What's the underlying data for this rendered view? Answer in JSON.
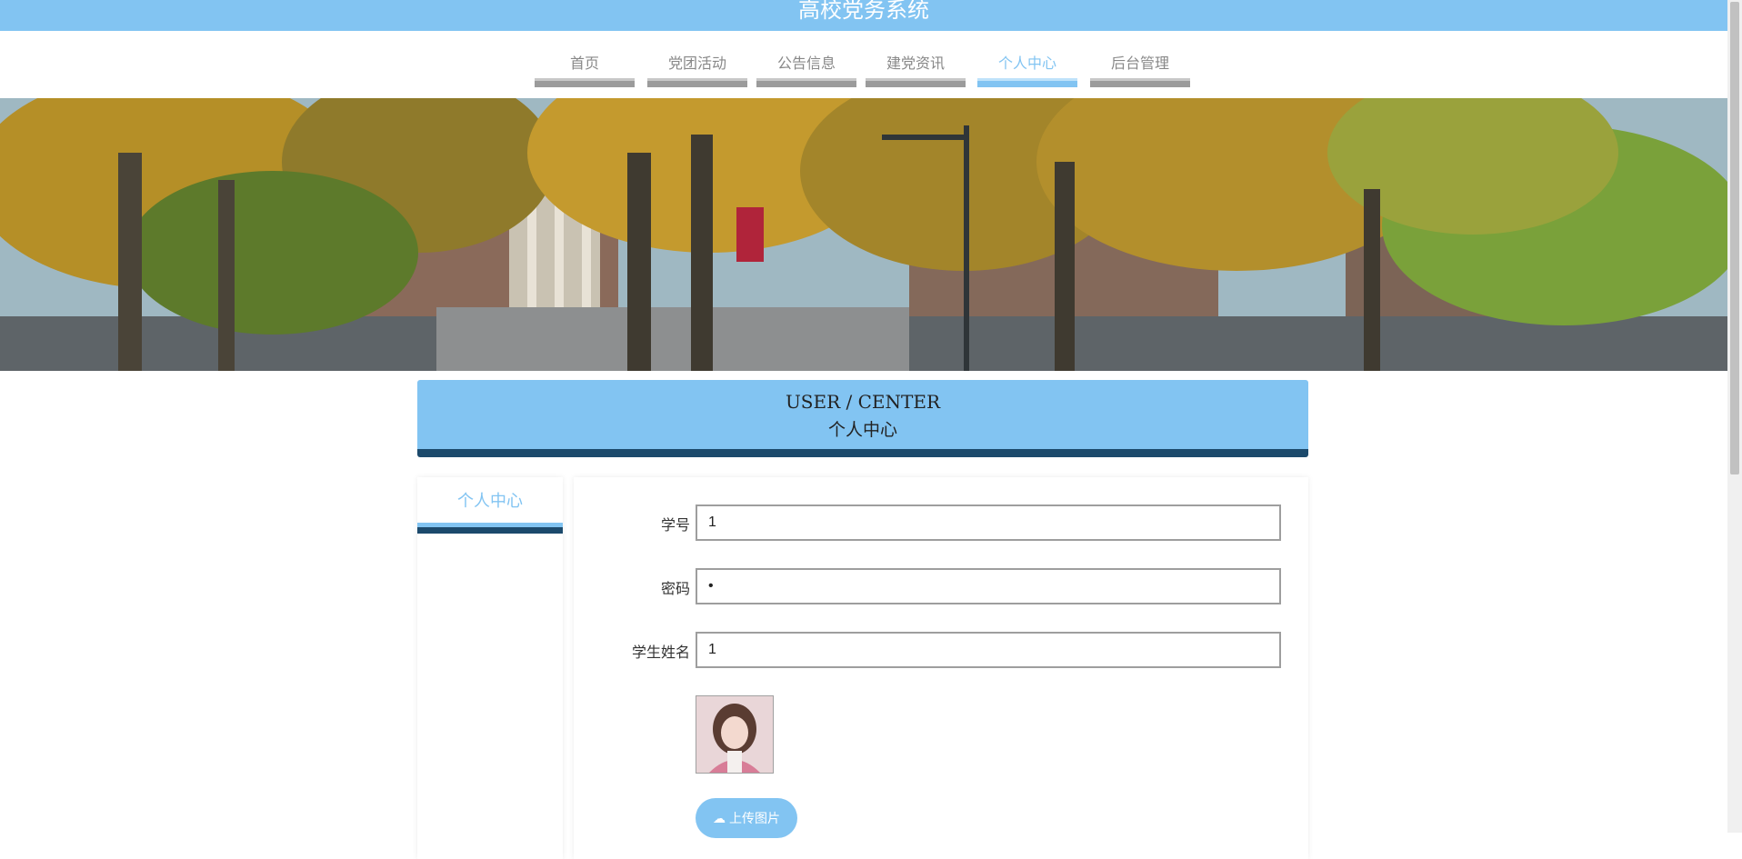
{
  "site": {
    "title": "高校党务系统"
  },
  "nav": {
    "items": [
      {
        "label": "首页",
        "active": false
      },
      {
        "label": "党团活动",
        "active": false
      },
      {
        "label": "公告信息",
        "active": false
      },
      {
        "label": "建党资讯",
        "active": false
      },
      {
        "label": "个人中心",
        "active": true
      },
      {
        "label": "后台管理",
        "active": false
      }
    ]
  },
  "header": {
    "en": "USER / CENTER",
    "cn": "个人中心"
  },
  "sidebar": {
    "items": [
      {
        "label": "个人中心",
        "active": true
      }
    ]
  },
  "form": {
    "student_id_label": "学号",
    "student_id_value": "1",
    "password_label": "密码",
    "password_value": "1",
    "name_label": "学生姓名",
    "name_value": "1",
    "upload_label": "上传图片"
  },
  "colors": {
    "accent": "#82c4f2",
    "dark": "#1c4a6c",
    "nav_inactive": "#9b9b9b"
  },
  "icons": {
    "upload": "cloud-upload-icon"
  }
}
